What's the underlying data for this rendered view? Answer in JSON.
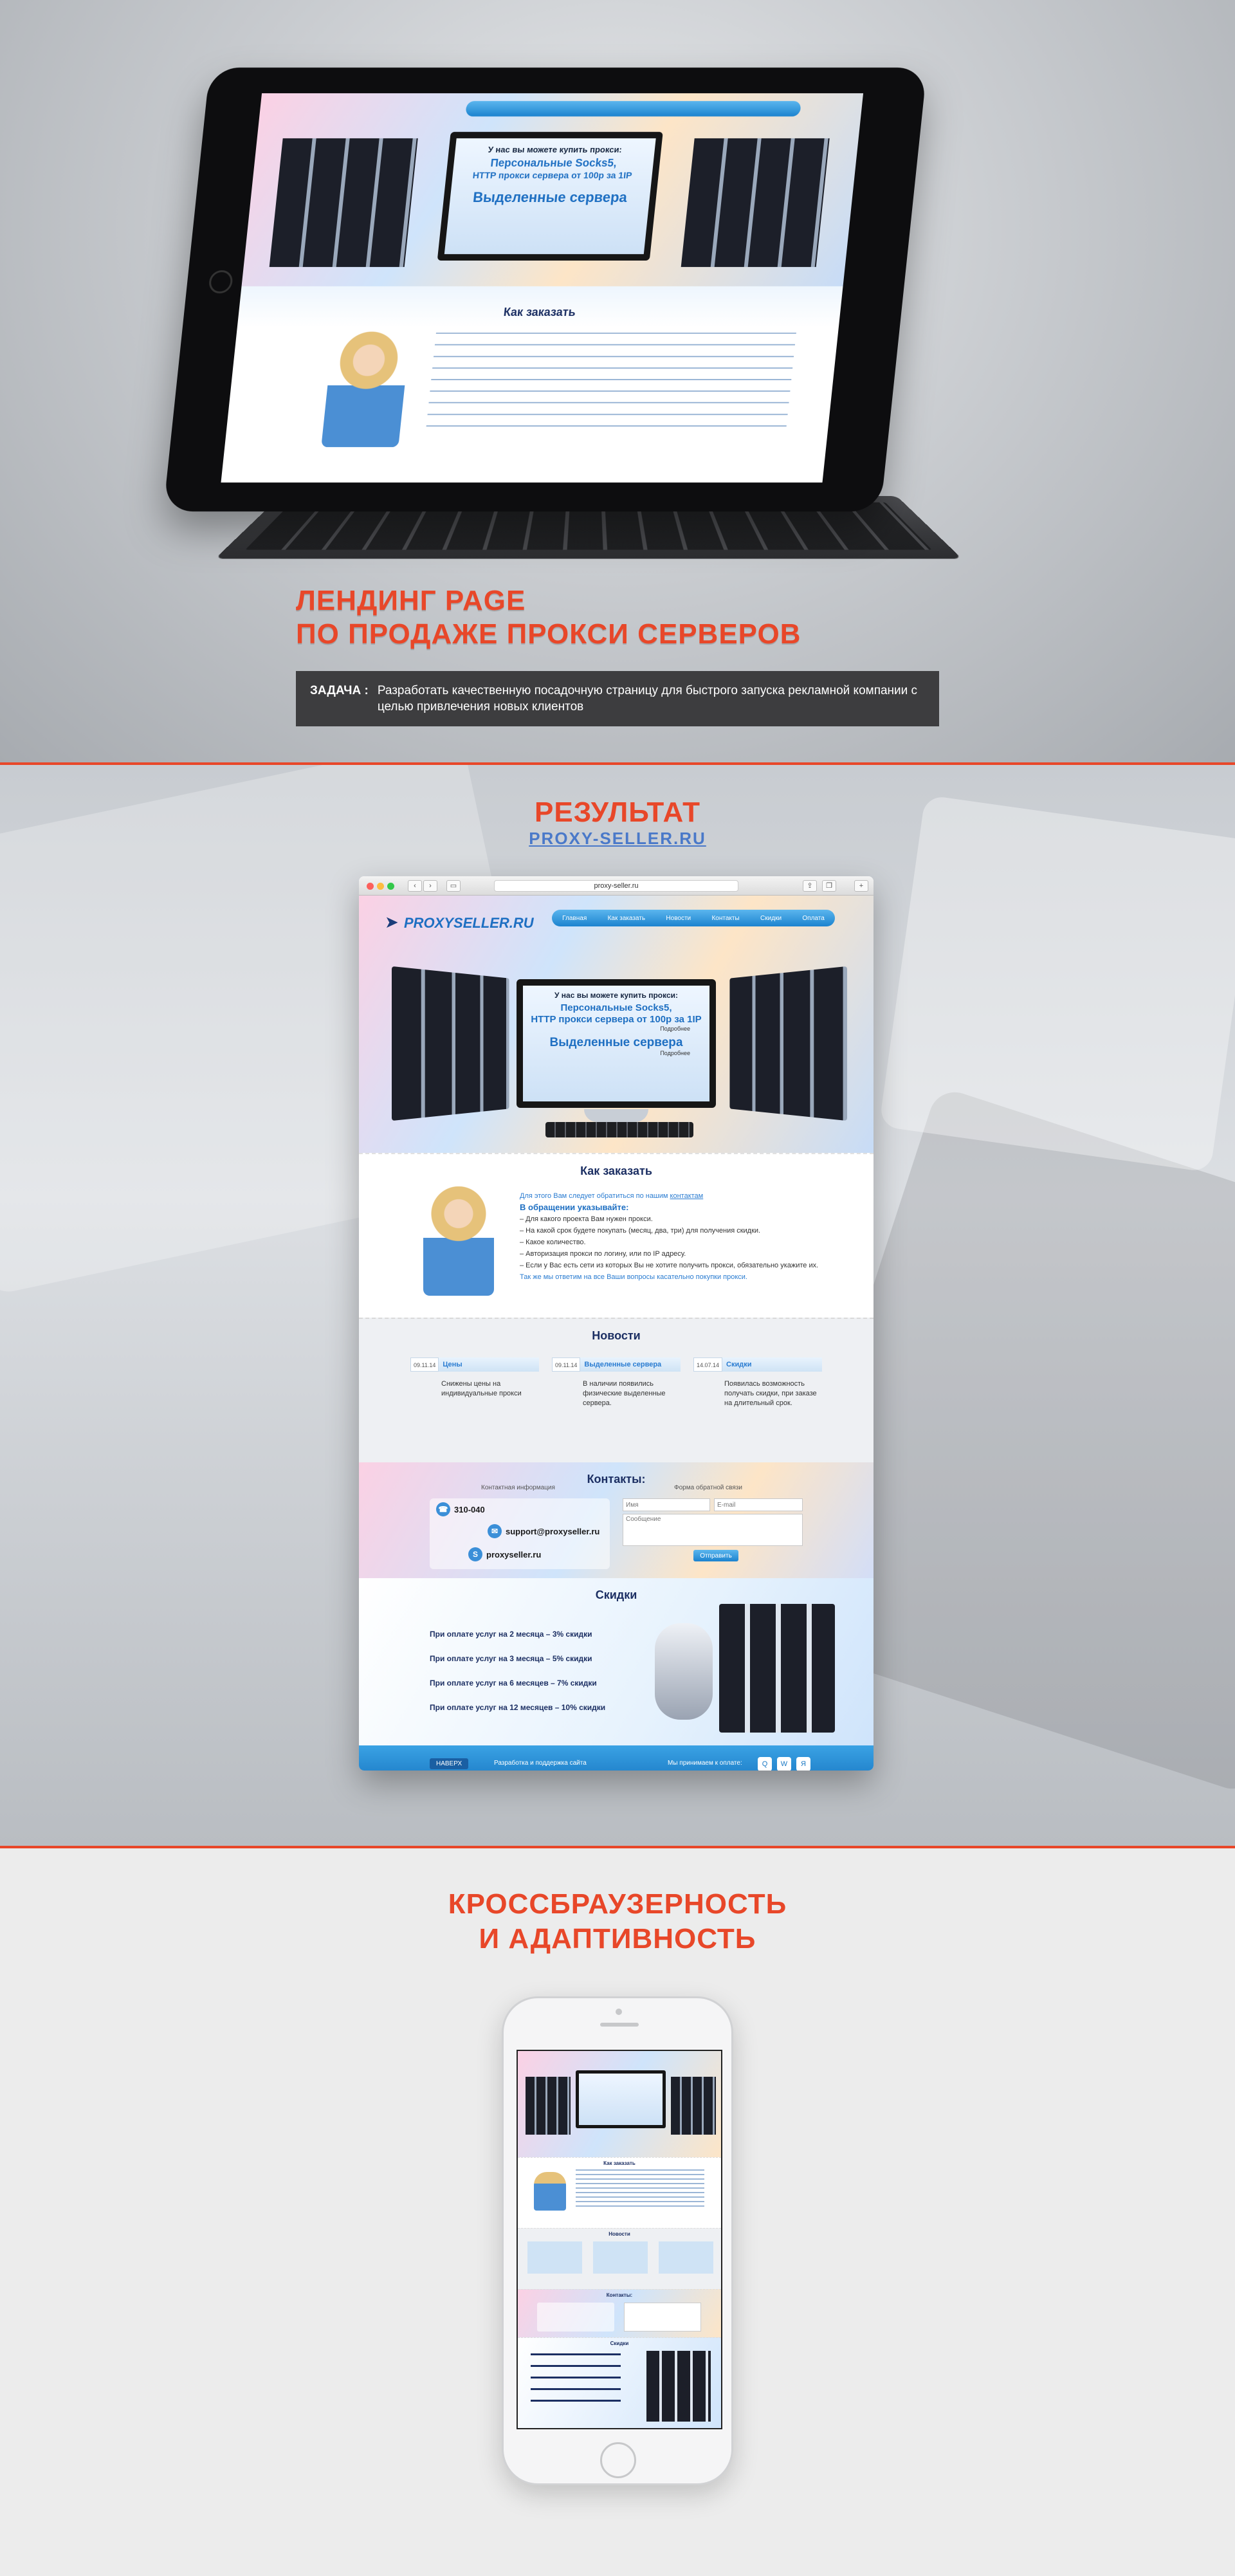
{
  "hero": {
    "title_line1": "ЛЕНДИНГ PAGE",
    "title_line2": "ПО ПРОДАЖЕ ПРОКСИ СЕРВЕРОВ",
    "task_label": "ЗАДАЧА :",
    "task_text": "Разработать качественную посадочную страницу для быстрого запуска рекламной компании с целью привлечения новых клиентов"
  },
  "result": {
    "title": "РЕЗУЛЬТАТ",
    "subtitle": "PROXY-SELLER.RU"
  },
  "browser": {
    "url": "proxy-seller.ru"
  },
  "site": {
    "logo": "PROXYSELLER.RU",
    "nav": [
      "Главная",
      "Как заказать",
      "Новости",
      "Контакты",
      "Скидки",
      "Оплата"
    ],
    "monitor": {
      "line1": "У нас вы можете купить прокси:",
      "line2": "Персональные Socks5,",
      "line3": "HTTP прокси сервера от 100р за 1IP",
      "line4": "Подробнее",
      "line5": "Выделенные сервера",
      "line6": "Подробнее"
    },
    "order": {
      "title": "Как заказать",
      "intro": "Для этого Вам следует обратиться по нашим",
      "intro_link": "контактам",
      "heading": "В обращении указывайте:",
      "items": [
        "– Для какого проекта Вам нужен прокси.",
        "– На какой срок будете покупать (месяц, два, три) для получения скидки.",
        "– Какое количество.",
        "– Авторизация прокси по логину, или по IP адресу.",
        "– Если у Вас есть сети из которых Вы не хотите получить прокси, обязательно укажите их."
      ],
      "outro": "Так же мы ответим на все Ваши вопросы касательно покупки прокси."
    },
    "news": {
      "title": "Новости",
      "items": [
        {
          "date": "09.11.14",
          "title": "Цены",
          "body": "Снижены цены на индивидуальные прокси"
        },
        {
          "date": "09.11.14",
          "title": "Выделенные сервера",
          "body": "В наличии появились физические выделенные сервера."
        },
        {
          "date": "14.07.14",
          "title": "Скидки",
          "body": "Появилась возможность получать скидки, при заказе на длительный срок."
        }
      ]
    },
    "contacts": {
      "title": "Контакты:",
      "info_caption": "Контактная информация",
      "form_caption": "Форма обратной связи",
      "phone": "310-040",
      "email": "support@proxyseller.ru",
      "skype": "proxyseller.ru",
      "name_placeholder": "Имя",
      "email_placeholder": "E-mail",
      "message_placeholder": "Сообщение",
      "send": "Отправить"
    },
    "discounts": {
      "title": "Скидки",
      "items": [
        "При оплате услуг на 2 месяца – 3% скидки",
        "При оплате услуг на 3 месяца – 5% скидки",
        "При оплате услуг на 6 месяцев – 7% скидки",
        "При оплате услуг на 12 месяцев – 10% скидки"
      ]
    },
    "footer": {
      "up": "НАВЕРХ",
      "dev": "Разработка и поддержка сайта",
      "social": "Мы принимаем к оплате:"
    }
  },
  "cross": {
    "title_line1": "КРОССБРАУЗЕРНОСТЬ",
    "title_line2": "И АДАПТИВНОСТЬ",
    "phone": {
      "order_title": "Как заказать",
      "news_title": "Новости",
      "contacts_title": "Контакты:",
      "discounts_title": "Скидки"
    }
  },
  "colors": {
    "accent": "#e84729",
    "brand_blue": "#1e6fc2",
    "task_box": "#3d3d3f"
  }
}
